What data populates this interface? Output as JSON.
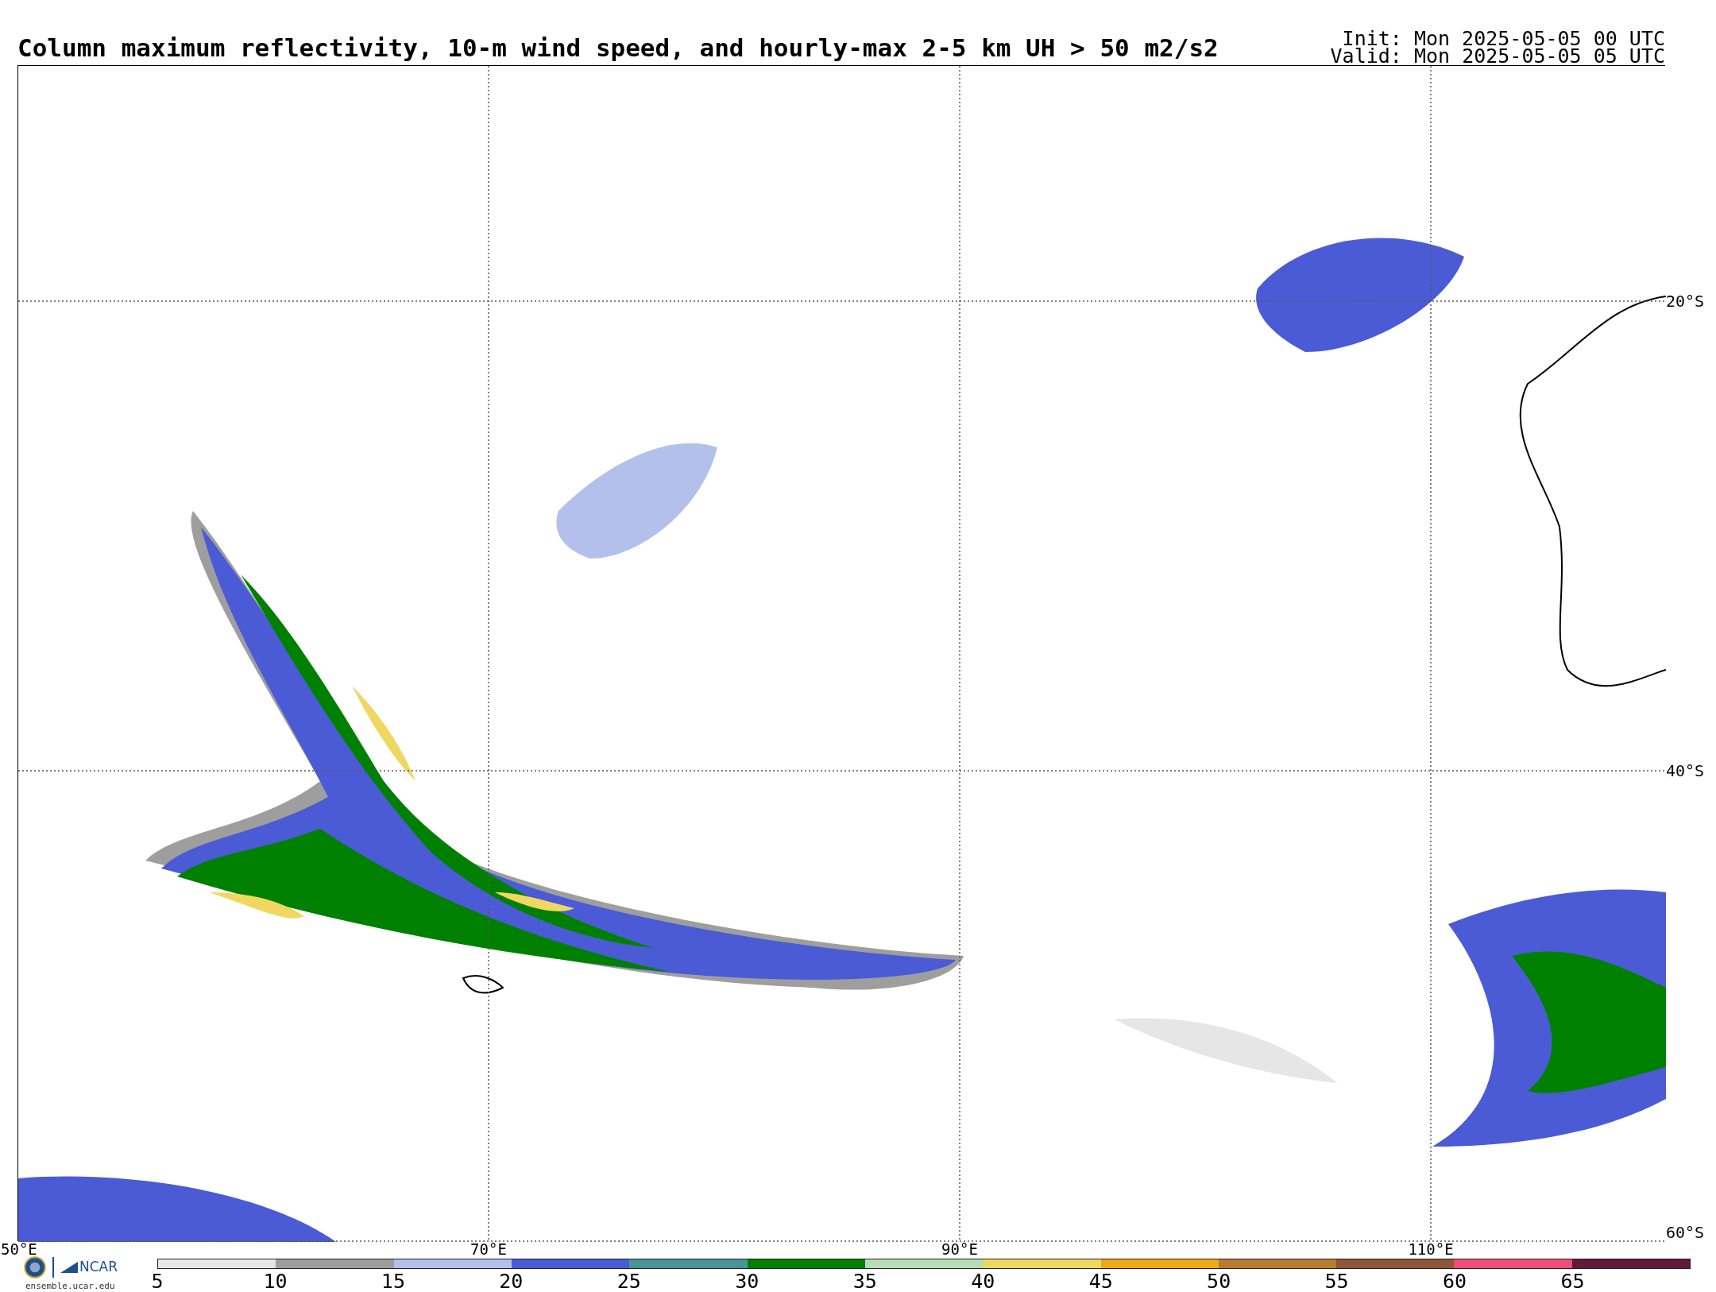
{
  "title": "Column maximum reflectivity, 10-m wind speed, and hourly-max 2-5 km UH > 50 m2/s2",
  "init": "Init: Mon 2025-05-05 00 UTC",
  "valid": "Valid: Mon 2025-05-05 05 UTC",
  "map": {
    "longitude_labels": [
      "50°E",
      "70°E",
      "90°E",
      "110°E"
    ],
    "latitude_labels": [
      "20°S",
      "40°S",
      "60°S"
    ]
  },
  "logos": {
    "ncar": "NCAR",
    "site": "ensemble.ucar.edu"
  },
  "colorbar": {
    "bins": [
      {
        "label": "5",
        "color": "#e6e6e6"
      },
      {
        "label": "10",
        "color": "#9e9e9e"
      },
      {
        "label": "15",
        "color": "#b4c0ec"
      },
      {
        "label": "20",
        "color": "#4b5bd6"
      },
      {
        "label": "25",
        "color": "#479595"
      },
      {
        "label": "30",
        "color": "#008000"
      },
      {
        "label": "35",
        "color": "#b8dcb8"
      },
      {
        "label": "40",
        "color": "#f0d860"
      },
      {
        "label": "45",
        "color": "#f0aa18"
      },
      {
        "label": "50",
        "color": "#b87c30"
      },
      {
        "label": "55",
        "color": "#8c5638"
      },
      {
        "label": "60",
        "color": "#f04c78"
      },
      {
        "label": "65",
        "color": "#64183a"
      }
    ]
  }
}
